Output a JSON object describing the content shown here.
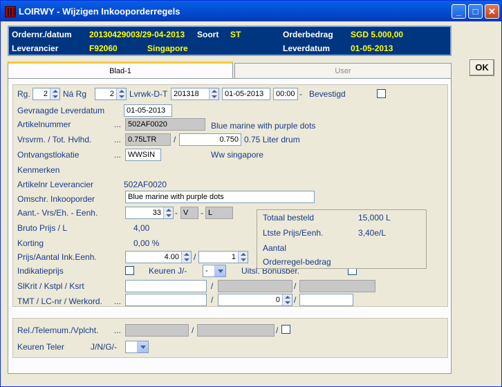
{
  "window": {
    "title": "LOIRWY - Wijzigen Inkooporderregels",
    "minimize": "_",
    "maximize": "□",
    "close": "✕"
  },
  "header": {
    "order_label": "Ordernr./datum",
    "order_value": "20130429003/29-04-2013",
    "soort_label": "Soort",
    "soort_value": "ST",
    "orderbedrag_label": "Orderbedrag",
    "orderbedrag_value": "SGD 5.000,00",
    "leverancier_label": "Leverancier",
    "leverancier_code": "F92060",
    "leverancier_name": "Singapore",
    "leverdatum_label": "Leverdatum",
    "leverdatum_value": "01-05-2013"
  },
  "ok_label": "OK",
  "tabs": [
    "Blad-1",
    "User"
  ],
  "form": {
    "rg_label": "Rg.",
    "rg_value": "2",
    "na_rg_label": "Ná Rg",
    "na_rg_value": "2",
    "lvrwk_label": "Lvrwk-D-T",
    "lvrwk_week": "201318",
    "lvrwk_date": "01-05-2013",
    "lvrwk_time": "00:00",
    "dash": "-",
    "bevestigd_label": "Bevestigd",
    "gevraagde_label": "Gevraagde Leverdatum",
    "gevraagde_value": "01-05-2013",
    "artikelnummer_label": "Artikelnummer",
    "artikelnummer_value": "502AF0020",
    "artikel_desc": "Blue marine with purple dots",
    "vrsvrm_label": "Vrsvrm. / Tot. Hvlhd.",
    "vrsvrm_value": "0.75LTR",
    "slash": "/",
    "tot_hvlhd_value": "0.750",
    "tot_hvlhd_desc": "0.75 Liter drum",
    "ontvangst_label": "Ontvangstlokatie",
    "ontvangst_value": "WWSIN",
    "ontvangst_desc": "Ww singapore",
    "kenmerken_label": "Kenmerken",
    "artnr_lev_label": "Artikelnr Leverancier",
    "artnr_lev_value": "502AF0020",
    "omschr_label": "Omschr. Inkooporder",
    "omschr_value": "Blue marine with purple dots",
    "aant_label": "Aant.- Vrs/Eh. - Eenh.",
    "aant_value": "33",
    "vrs_value": "V",
    "eenh_value": "L",
    "bruto_label": "Bruto Prijs / L",
    "bruto_value": "4,00",
    "korting_label": "Korting",
    "korting_value": "0,00 %",
    "prijs_label": "Prijs/Aantal Ink.Eenh.",
    "prijs_value": "4.00",
    "aantal_ink_value": "1",
    "indicatie_label": "Indikatieprijs",
    "keuren_label": "Keuren J/-",
    "keuren_value": "-",
    "uitsl_label": "Uitsl. Bonusber.",
    "slkrit_label": "SlKrit / Kstpl / Ksrt",
    "tmt_label": "TMT / LC-nr / Werkord.",
    "tmt_lc_value": "0",
    "dots": "...",
    "rel_label": "Rel./Telernum./Vplcht.",
    "keuren_teler_label": "Keuren Teler",
    "jng_label": "J/N/G/-"
  },
  "info": {
    "totaal_label": "Totaal besteld",
    "totaal_value": "15,000 L",
    "ltste_label": "Ltste Prijs/Eenh.",
    "ltste_value": "3,40e/L",
    "aantal_label": "Aantal",
    "orderregel_label": "Orderregel-bedrag"
  }
}
